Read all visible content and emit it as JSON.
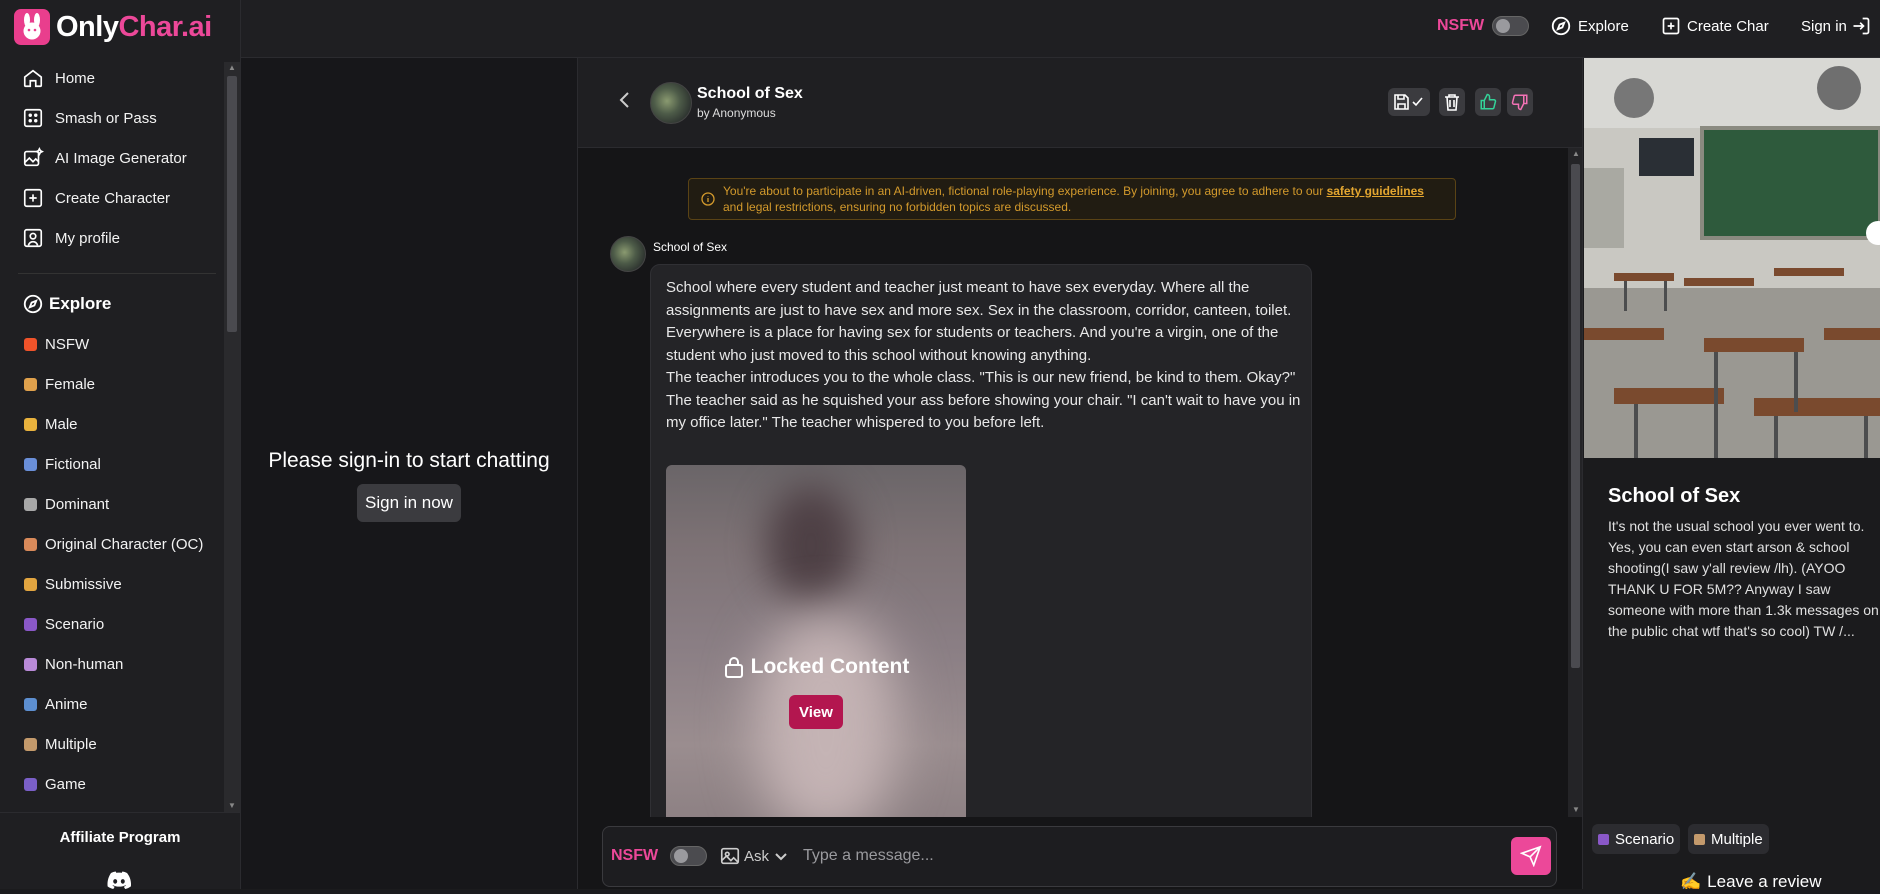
{
  "brand": {
    "part1": "Only",
    "part2": "Char.ai"
  },
  "topbar": {
    "nsfw": "NSFW",
    "explore": "Explore",
    "create": "Create Char",
    "signin": "Sign in"
  },
  "sidebar": {
    "main": [
      {
        "label": "Home",
        "icon": "home-icon"
      },
      {
        "label": "Smash or Pass",
        "icon": "grid-icon"
      },
      {
        "label": "AI Image Generator",
        "icon": "image-gen-icon"
      },
      {
        "label": "Create Character",
        "icon": "plus-square-icon"
      },
      {
        "label": "My profile",
        "icon": "user-square-icon"
      }
    ],
    "explore_title": "Explore",
    "explore": [
      {
        "label": "NSFW",
        "color": "#f0532a"
      },
      {
        "label": "Female",
        "color": "#e0a14c"
      },
      {
        "label": "Male",
        "color": "#e9b23d"
      },
      {
        "label": "Fictional",
        "color": "#6a8fd9"
      },
      {
        "label": "Dominant",
        "color": "#a8a8a8"
      },
      {
        "label": "Original Character (OC)",
        "color": "#d98a5a"
      },
      {
        "label": "Submissive",
        "color": "#e2a540"
      },
      {
        "label": "Scenario",
        "color": "#8a58c8"
      },
      {
        "label": "Non-human",
        "color": "#b98ad8"
      },
      {
        "label": "Anime",
        "color": "#5d8fd1"
      },
      {
        "label": "Multiple",
        "color": "#c49a6c"
      },
      {
        "label": "Game",
        "color": "#7a5fc8"
      }
    ],
    "affiliate": "Affiliate Program"
  },
  "left": {
    "prompt": "Please sign-in to start chatting",
    "button": "Sign in now"
  },
  "chat": {
    "title": "School of Sex",
    "author": "by Anonymous",
    "notice_before": "You're about to participate in an AI-driven, fictional role-playing experience. By joining, you agree to adhere to our ",
    "notice_link": "safety guidelines",
    "notice_after": " and legal restrictions, ensuring no forbidden topics are discussed.",
    "message_sender": "School of Sex",
    "message_p1": "School where every student and teacher just meant to have sex everyday. Where all the assignments are just to have sex and more sex. Sex in the classroom, corridor, canteen, toilet. Everywhere is a place for having sex for students or teachers. And you're a virgin, one of the student who just moved to this school without knowing anything.",
    "message_p2": "The teacher introduces you to the whole class. \"This is our new friend, be kind to them. Okay?\" The teacher said as he squished your ass before showing your chair. \"I can't wait to have you in my office later.\" The teacher whispered to you before left.",
    "locked_label": "Locked Content",
    "view_button": "View"
  },
  "composer": {
    "nsfw": "NSFW",
    "ask": "Ask",
    "placeholder": "Type a message..."
  },
  "right": {
    "title": "School of Sex",
    "description": "It's not the usual school you ever went to. Yes, you can even start arson & school shooting(I saw y'all review /lh). (AYOO THANK U FOR 5M?? Anyway I saw someone with more than 1.3k messages on the public chat wtf that's so cool) TW /...",
    "tags": [
      {
        "label": "Scenario",
        "color": "#8a58c8"
      },
      {
        "label": "Multiple",
        "color": "#c49a6c"
      }
    ],
    "review": "Leave a review"
  }
}
